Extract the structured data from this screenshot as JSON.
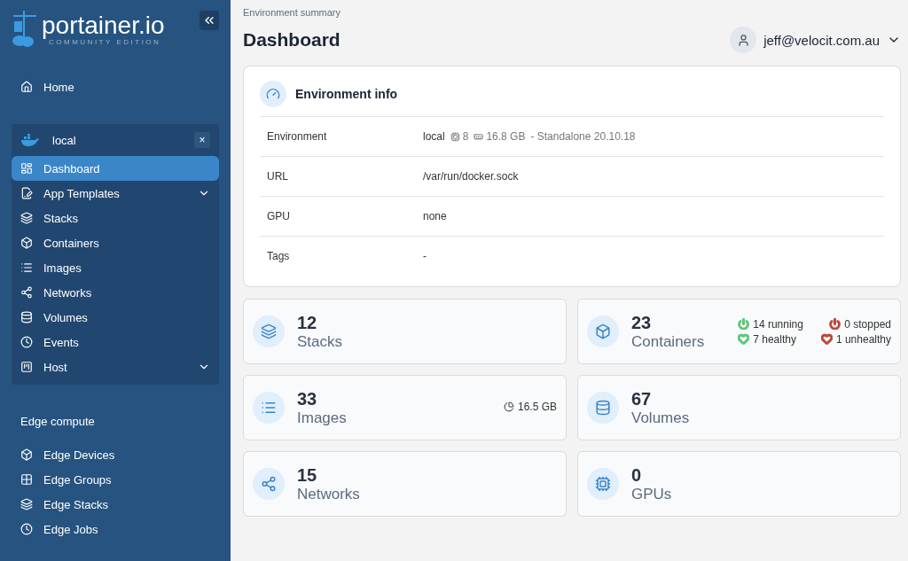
{
  "sidebar": {
    "logo": {
      "name": "portainer.io",
      "edition": "COMMUNITY EDITION"
    },
    "home": {
      "label": "Home",
      "selected": false
    },
    "environment": {
      "name": "local",
      "close": "×",
      "items": [
        {
          "label": "Dashboard",
          "selected": true,
          "has_submenu": false
        },
        {
          "label": "App Templates",
          "selected": false,
          "has_submenu": true
        },
        {
          "label": "Stacks",
          "selected": false,
          "has_submenu": false
        },
        {
          "label": "Containers",
          "selected": false,
          "has_submenu": false
        },
        {
          "label": "Images",
          "selected": false,
          "has_submenu": false
        },
        {
          "label": "Networks",
          "selected": false,
          "has_submenu": false
        },
        {
          "label": "Volumes",
          "selected": false,
          "has_submenu": false
        },
        {
          "label": "Events",
          "selected": false,
          "has_submenu": false
        },
        {
          "label": "Host",
          "selected": false,
          "has_submenu": true
        }
      ]
    },
    "edge": {
      "heading": "Edge compute",
      "items": [
        {
          "label": "Edge Devices",
          "selected": false
        },
        {
          "label": "Edge Groups",
          "selected": false
        },
        {
          "label": "Edge Stacks",
          "selected": false
        },
        {
          "label": "Edge Jobs",
          "selected": false
        }
      ]
    }
  },
  "header": {
    "breadcrumb": "Environment summary",
    "title": "Dashboard",
    "user": "jeff@velocit.com.au"
  },
  "environment_info": {
    "title": "Environment info",
    "rows": [
      {
        "kind": "environment",
        "label": "Environment",
        "name": "local",
        "cpu": "8",
        "memory": "16.8 GB",
        "details": "- Standalone 20.10.18"
      },
      {
        "kind": "text",
        "label": "URL",
        "value": "/var/run/docker.sock"
      },
      {
        "kind": "text",
        "label": "GPU",
        "value": "none"
      },
      {
        "kind": "text",
        "label": "Tags",
        "value": "-"
      }
    ]
  },
  "stats": [
    {
      "value": "12",
      "label": "Stacks"
    },
    {
      "value": "23",
      "label": "Containers",
      "badges": [
        {
          "kind": "power",
          "text": "14 running",
          "color": "#5fc77a"
        },
        {
          "kind": "power",
          "text": "0 stopped",
          "color": "#c0473d"
        },
        {
          "kind": "heart",
          "text": "7 healthy",
          "color": "#5fc77a"
        },
        {
          "kind": "heart",
          "text": "1 unhealthy",
          "color": "#c0473d"
        }
      ]
    },
    {
      "value": "33",
      "label": "Images",
      "size": "16.5 GB"
    },
    {
      "value": "67",
      "label": "Volumes"
    },
    {
      "value": "15",
      "label": "Networks"
    },
    {
      "value": "0",
      "label": "GPUs"
    }
  ]
}
